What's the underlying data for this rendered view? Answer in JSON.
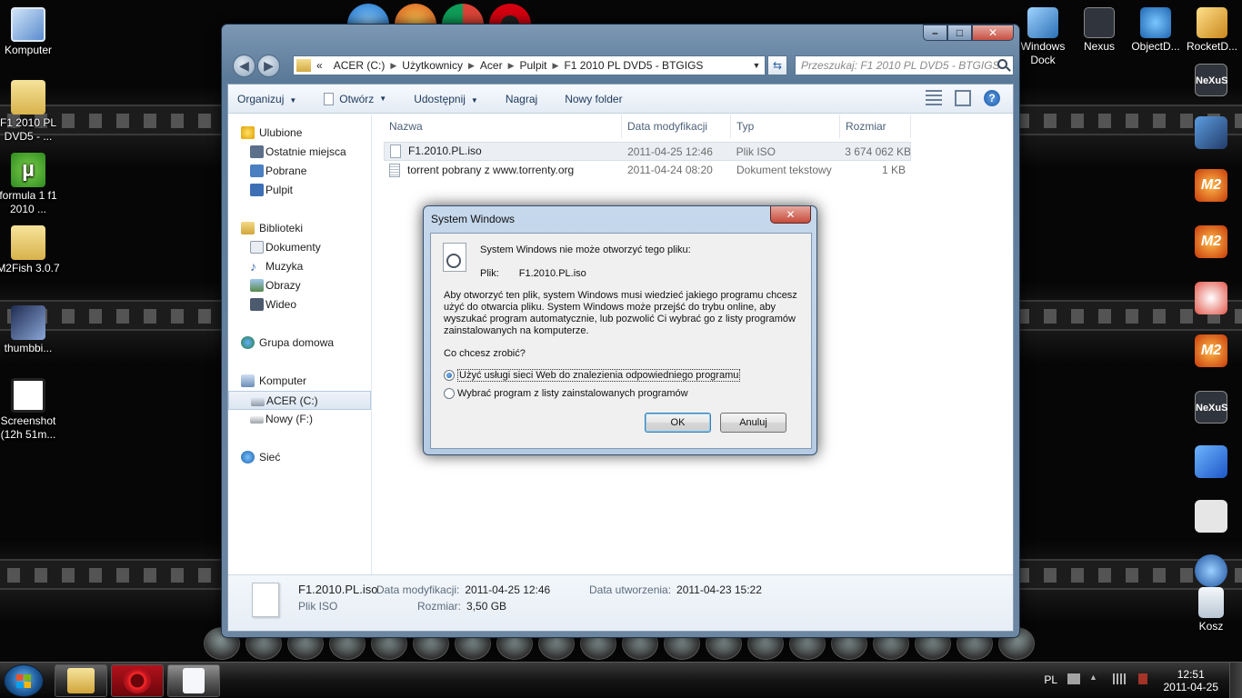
{
  "desktop": {
    "icons": [
      {
        "label": "Komputer"
      },
      {
        "label": "F1 2010 PL DVD5 - ..."
      },
      {
        "label": "formula 1 f1 2010 ..."
      },
      {
        "label": "M2Fish 3.0.7"
      },
      {
        "label": "thumbbi..."
      },
      {
        "label": "Screenshot (12h 51m..."
      }
    ],
    "right_icons": [
      {
        "label": "Windows Dock"
      },
      {
        "label": "Nexus"
      },
      {
        "label": "ObjectD..."
      },
      {
        "label": "RocketD..."
      }
    ],
    "side_icons": {
      "nexus": "NeXuS",
      "m2": "M2",
      "kosz": "Kosz"
    }
  },
  "explorer": {
    "address": {
      "prefix": "«",
      "crumbs": [
        "ACER (C:)",
        "Użytkownicy",
        "Acer",
        "Pulpit",
        "F1 2010 PL DVD5 - BTGIGS"
      ]
    },
    "search_placeholder": "Przeszukaj: F1 2010 PL DVD5 - BTGIGS",
    "toolbar": {
      "organize": "Organizuj",
      "open": "Otwórz",
      "share": "Udostępnij",
      "burn": "Nagraj",
      "new_folder": "Nowy folder"
    },
    "nav": {
      "favorites": "Ulubione",
      "recent": "Ostatnie miejsca",
      "downloads": "Pobrane",
      "desktop": "Pulpit",
      "libraries": "Biblioteki",
      "documents": "Dokumenty",
      "music": "Muzyka",
      "pictures": "Obrazy",
      "videos": "Wideo",
      "homegroup": "Grupa domowa",
      "computer": "Komputer",
      "drive_c": "ACER (C:)",
      "drive_f": "Nowy (F:)",
      "network": "Sieć"
    },
    "columns": {
      "name": "Nazwa",
      "modified": "Data modyfikacji",
      "type": "Typ",
      "size": "Rozmiar"
    },
    "files": [
      {
        "name": "F1.2010.PL.iso",
        "modified": "2011-04-25 12:46",
        "type": "Plik ISO",
        "size": "3 674 062 KB"
      },
      {
        "name": "torrent pobrany z www.torrenty.org",
        "modified": "2011-04-24 08:20",
        "type": "Dokument tekstowy",
        "size": "1 KB"
      }
    ],
    "details": {
      "name": "F1.2010.PL.iso",
      "type": "Plik ISO",
      "modified_label": "Data modyfikacji:",
      "modified": "2011-04-25 12:46",
      "created_label": "Data utworzenia:",
      "created": "2011-04-23 15:22",
      "size_label": "Rozmiar:",
      "size": "3,50 GB"
    }
  },
  "dialog": {
    "title": "System Windows",
    "message": "System Windows nie może otworzyć tego pliku:",
    "file_label": "Plik:",
    "file_name": "F1.2010.PL.iso",
    "explanation": "Aby otworzyć ten plik, system Windows musi wiedzieć jakiego programu chcesz użyć do otwarcia pliku. System Windows może przejść do trybu online, aby wyszukać program automatycznie, lub pozwolić Ci wybrać go z listy programów zainstalowanych na komputerze.",
    "question": "Co chcesz zrobić?",
    "option_web": "Użyć usługi sieci Web do znalezienia odpowiedniego programu",
    "option_list": "Wybrać program z listy zainstalowanych programów",
    "ok": "OK",
    "cancel": "Anuluj"
  },
  "taskbar": {
    "lang": "PL",
    "time": "12:51",
    "date": "2011-04-25"
  }
}
